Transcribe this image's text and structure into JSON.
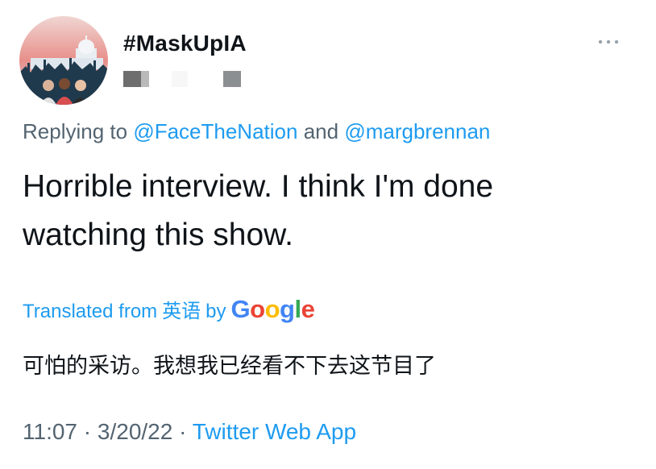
{
  "tweet": {
    "display_name": "#MaskUpIA",
    "reply_prefix": "Replying to",
    "reply_mentions": [
      "@FaceTheNation",
      "@margbrennan"
    ],
    "reply_conjunction": "and",
    "text_line_1": "Horrible interview. I think I'm done",
    "text_line_2": "watching this show.",
    "translated_from_label": "Translated from",
    "translated_language": "英语",
    "translated_by_label": "by",
    "translation_provider": "Google",
    "translated_text": "可怕的采访。我想我已经看不下去这节目了",
    "time": "11:07",
    "separator": "·",
    "date": "3/20/22",
    "source_app": "Twitter Web App"
  },
  "icons": {
    "more": "more-horizontal-icon",
    "avatar": "protest-crowd-capitol-avatar"
  },
  "colors": {
    "link": "#1d9bf0",
    "secondary_text": "#536471",
    "primary_text": "#0f1419"
  }
}
